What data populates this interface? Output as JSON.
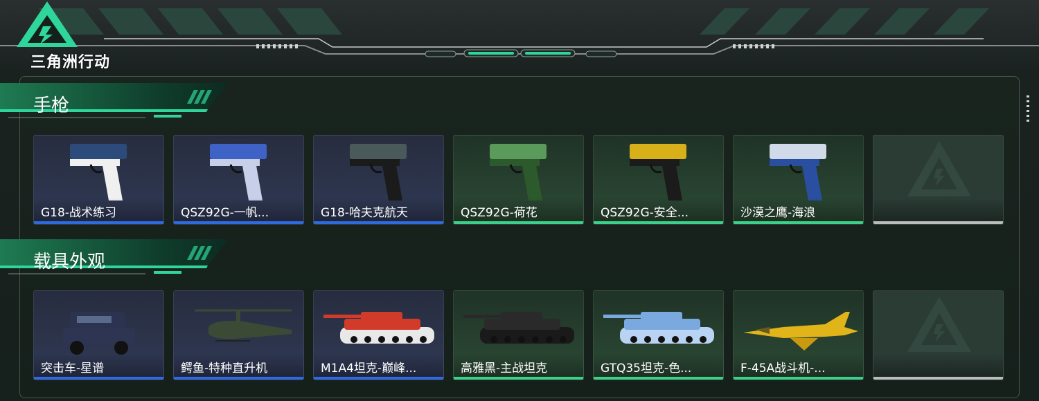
{
  "app": {
    "logo_text": "三角洲行动"
  },
  "colors": {
    "rare_blue": "#2f6be0",
    "epic_green": "#3bd18a",
    "empty_gray": "#b9bdbb",
    "accent": "#2fd59a"
  },
  "sections": [
    {
      "title": "手枪",
      "items": [
        {
          "name": "G18-战术练习",
          "rarity": "blue",
          "icon": "pistol-icon"
        },
        {
          "name": "QSZ92G-一帆...",
          "rarity": "blue",
          "icon": "pistol-icon"
        },
        {
          "name": "G18-哈夫克航天",
          "rarity": "blue",
          "icon": "pistol-icon"
        },
        {
          "name": "QSZ92G-荷花",
          "rarity": "green",
          "icon": "pistol-icon"
        },
        {
          "name": "QSZ92G-安全...",
          "rarity": "green",
          "icon": "pistol-icon"
        },
        {
          "name": "沙漠之鹰-海浪",
          "rarity": "green",
          "icon": "pistol-icon"
        },
        {
          "name": "",
          "rarity": "empty",
          "icon": "empty-slot-icon"
        }
      ]
    },
    {
      "title": "载具外观",
      "items": [
        {
          "name": "突击车-星谱",
          "rarity": "blue",
          "icon": "armored-car-icon"
        },
        {
          "name": "鳄鱼-特种直升机",
          "rarity": "blue",
          "icon": "helicopter-icon"
        },
        {
          "name": "M1A4坦克-巅峰...",
          "rarity": "blue",
          "icon": "tank-icon"
        },
        {
          "name": "高雅黑-主战坦克",
          "rarity": "green",
          "icon": "tank-icon"
        },
        {
          "name": "GTQ35坦克-色...",
          "rarity": "green",
          "icon": "tank-icon"
        },
        {
          "name": "F-45A战斗机-...",
          "rarity": "green",
          "icon": "jet-icon"
        },
        {
          "name": "",
          "rarity": "empty",
          "icon": "empty-slot-icon"
        }
      ]
    }
  ]
}
